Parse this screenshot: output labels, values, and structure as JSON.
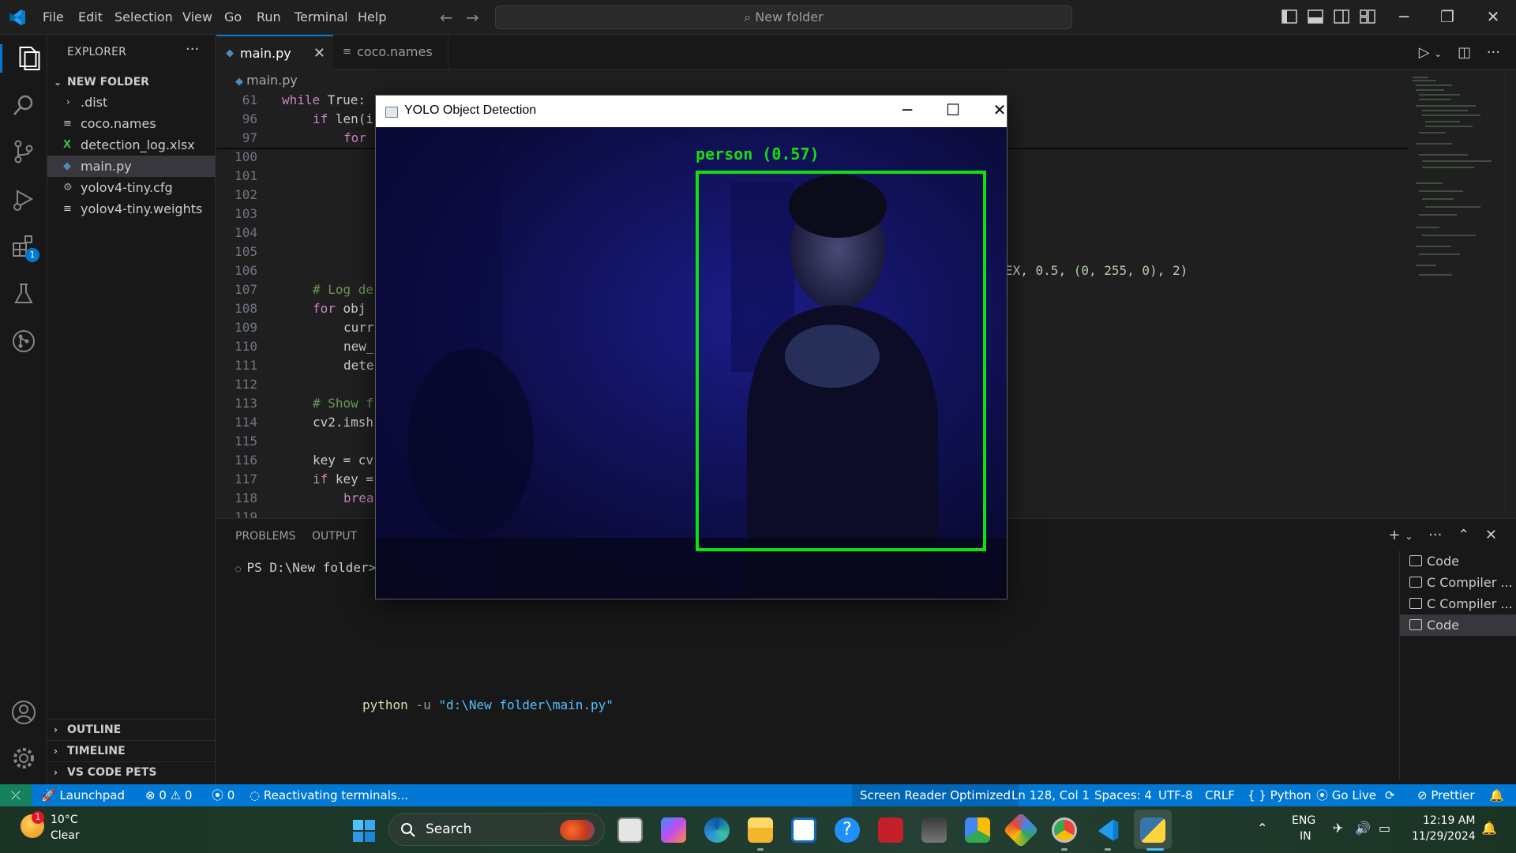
{
  "titlebar": {
    "menu": [
      "File",
      "Edit",
      "Selection",
      "View",
      "Go",
      "Run",
      "Terminal",
      "Help"
    ],
    "search_text": "New folder"
  },
  "sidebar": {
    "title": "EXPLORER",
    "folder": "NEW FOLDER",
    "files": [
      ".dist",
      "coco.names",
      "detection_log.xlsx",
      "main.py",
      "yolov4-tiny.cfg",
      "yolov4-tiny.weights"
    ],
    "sections": [
      "OUTLINE",
      "TIMELINE",
      "VS CODE PETS"
    ]
  },
  "activitybar": {
    "extensions_badge": "1"
  },
  "editor": {
    "tabs": [
      "main.py",
      "coco.names"
    ],
    "breadcrumb": "main.py",
    "lines": [
      {
        "n": "61"
      },
      {
        "n": "96"
      },
      {
        "n": "97"
      },
      {
        "n": "100"
      },
      {
        "n": "101"
      },
      {
        "n": "102"
      },
      {
        "n": "103"
      },
      {
        "n": "104"
      },
      {
        "n": "105"
      },
      {
        "n": "106"
      },
      {
        "n": "107"
      },
      {
        "n": "108"
      },
      {
        "n": "109"
      },
      {
        "n": "110"
      },
      {
        "n": "111"
      },
      {
        "n": "112"
      },
      {
        "n": "113"
      },
      {
        "n": "114"
      },
      {
        "n": "115"
      },
      {
        "n": "116"
      },
      {
        "n": "117"
      },
      {
        "n": "118"
      },
      {
        "n": "119"
      }
    ],
    "code": {
      "l61_kw": "while",
      "l61_rest": " True:",
      "l96_kw": "if",
      "l96_rest": " len(i",
      "l97_kw": "for",
      "l105_tail_a": "EX, ",
      "l105_tail_num1": "0.5",
      "l105_tail_b": ", ",
      "l105_tail_tuple": "(0, 255, 0)",
      "l105_tail_c": ", ",
      "l105_tail_num2": "2",
      "l105_tail_d": ")",
      "l107": "# Log de",
      "l108_kw": "for",
      "l108_rest": " obj",
      "l109": "curr",
      "l110": "new_",
      "l111": "dete",
      "l113": "# Show f",
      "l114": "cv2.imsh",
      "l116": "key = cv",
      "l117_kw": "if",
      "l117_rest": " key =",
      "l118": "brea"
    }
  },
  "panel": {
    "tabs": [
      "PROBLEMS",
      "OUTPUT"
    ],
    "prompt": "PS D:\\New folder> ",
    "prompt_partial": "py",
    "command_word": "python",
    "command_flag": " -u ",
    "command_path": "\"d:\\New folder\\main.py\"",
    "terminals": [
      "Code",
      "C Compiler ...",
      "C Compiler ...",
      "Code"
    ]
  },
  "statusbar": {
    "launchpad": "Launchpad",
    "errors": "0",
    "warnings": "0",
    "ports": "0",
    "task": "Reactivating terminals...",
    "screen_reader": "Screen Reader Optimized",
    "position": "Ln 128, Col 1",
    "spaces": "Spaces: 4",
    "encoding": "UTF-8",
    "eol": "CRLF",
    "language": "Python",
    "golive": "Go Live",
    "prettier": "Prettier"
  },
  "taskbar": {
    "weather_badge": "1",
    "temp": "10°C",
    "weather": "Clear",
    "search": "Search",
    "lang_top": "ENG",
    "lang_bottom": "IN",
    "time": "12:19 AM",
    "date": "11/29/2024"
  },
  "yolo_window": {
    "title": "YOLO Object Detection",
    "detection_label": "person (0.57)",
    "box_color": "#10e010"
  },
  "colors": {
    "accent": "#0078d4",
    "statusbar": "#0078d4",
    "remote": "#16825d"
  }
}
